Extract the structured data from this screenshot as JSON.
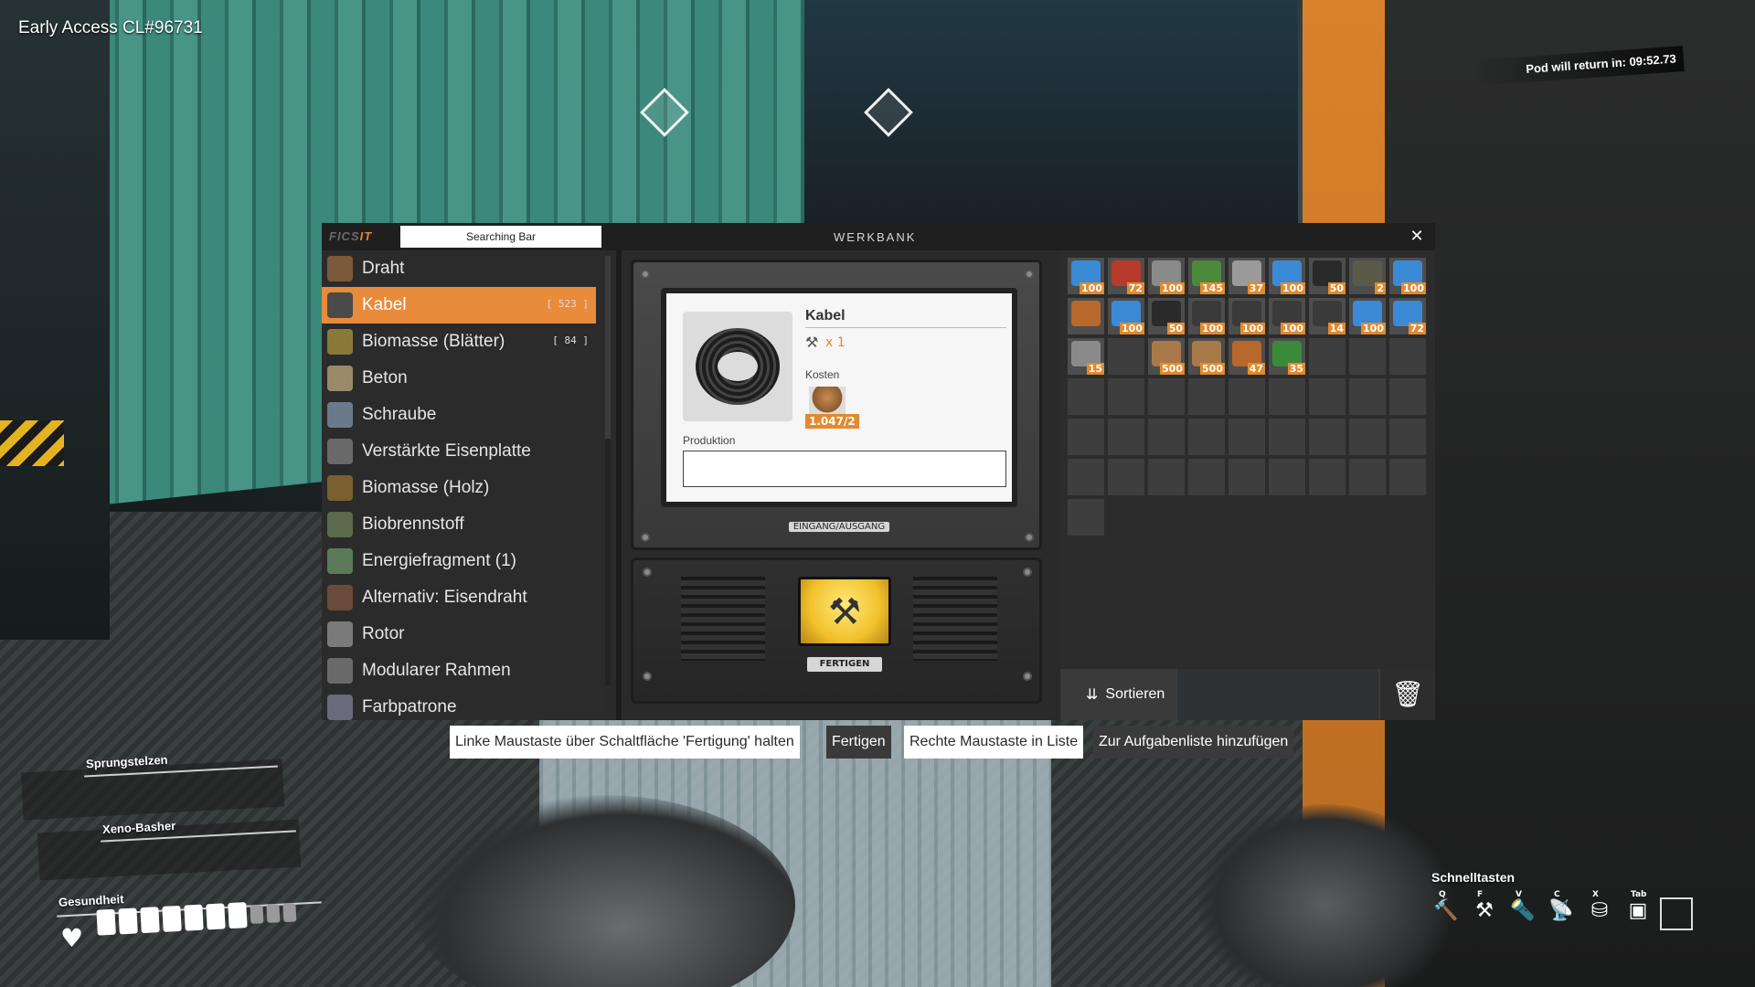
{
  "hud": {
    "version": "Early Access CL#96731",
    "pod_timer": "Pod will return in: 09:52.73"
  },
  "window": {
    "logo_left": "FICS",
    "logo_right": "IT",
    "search_text": "Searching Bar",
    "title": "WERKBANK",
    "close_label": "✕"
  },
  "recipes": [
    {
      "label": "Draht",
      "count": "",
      "color": "#7a5a3a"
    },
    {
      "label": "Kabel",
      "count": "[ 523 ]",
      "color": "#4a4a4a",
      "active": true
    },
    {
      "label": "Biomasse (Blätter)",
      "count": "[ 84 ]",
      "color": "#8a7a3a"
    },
    {
      "label": "Beton",
      "count": "",
      "color": "#9a8a6a"
    },
    {
      "label": "Schraube",
      "count": "",
      "color": "#6a7a8a"
    },
    {
      "label": "Verstärkte Eisenplatte",
      "count": "",
      "color": "#6a6a6a"
    },
    {
      "label": "Biomasse (Holz)",
      "count": "",
      "color": "#7a6030"
    },
    {
      "label": "Biobrennstoff",
      "count": "",
      "color": "#5a6a4a"
    },
    {
      "label": "Energiefragment (1)",
      "count": "",
      "color": "#5a7a5a"
    },
    {
      "label": "Alternativ: Eisendraht",
      "count": "",
      "color": "#6a4a3a"
    },
    {
      "label": "Rotor",
      "count": "",
      "color": "#7a7a7a"
    },
    {
      "label": "Modularer Rahmen",
      "count": "",
      "color": "#6a6a6a"
    },
    {
      "label": "Farbpatrone",
      "count": "",
      "color": "#6a6a7a"
    }
  ],
  "product": {
    "name": "Kabel",
    "quantity": "1",
    "tool_mult": "x 1",
    "cost_label": "Kosten",
    "cost_value": "1.047/2",
    "production_label": "Produktion",
    "io_label": "EINGANG/AUSGANG",
    "craft_label": "FERTIGEN"
  },
  "inventory": {
    "slots": [
      {
        "count": "100",
        "color": "#3a8ad6"
      },
      {
        "count": "72",
        "color": "#b83a2a"
      },
      {
        "count": "100",
        "color": "#8a8a8a"
      },
      {
        "count": "145",
        "color": "#4a8a3a"
      },
      {
        "count": "37",
        "color": "#9a9a9a"
      },
      {
        "count": "100",
        "color": "#3a8ad6"
      },
      {
        "count": "50",
        "color": "#2a2a2a"
      },
      {
        "count": "2",
        "color": "#5a5a4a"
      },
      {
        "count": "100",
        "color": "#3a8ad6"
      },
      {
        "count": "",
        "color": "#b8682a"
      },
      {
        "count": "100",
        "color": "#3a8ad6"
      },
      {
        "count": "50",
        "color": "#2a2a2a"
      },
      {
        "count": "100",
        "color": "#3a3a3a"
      },
      {
        "count": "100",
        "color": "#3a3a3a"
      },
      {
        "count": "100",
        "color": "#3a3a3a"
      },
      {
        "count": "14",
        "color": "#3a3a3a"
      },
      {
        "count": "100",
        "color": "#3a8ad6"
      },
      {
        "count": "72",
        "color": "#3a8ad6"
      },
      {
        "count": "15",
        "color": "#8a8a8a"
      },
      {
        "count": "",
        "color": ""
      },
      {
        "count": "500",
        "color": "#a87a4a"
      },
      {
        "count": "500",
        "color": "#a87a4a"
      },
      {
        "count": "47",
        "color": "#b8682a"
      },
      {
        "count": "35",
        "color": "#3a8a3a"
      },
      {
        "count": "",
        "color": ""
      },
      {
        "count": "",
        "color": ""
      },
      {
        "count": "",
        "color": ""
      }
    ],
    "empty_slot_count": 28,
    "sort_label": "Sortieren",
    "trash_label": "🗑"
  },
  "hints": {
    "hold_text": "Linke Maustaste über Schaltfläche 'Fertigung' halten",
    "hold_action": "Fertigen",
    "right_text": "Rechte Maustaste in Liste",
    "right_action": "Zur Aufgabenliste hinzufügen"
  },
  "equipment": {
    "slot1": "Sprungstelzen",
    "slot2": "Xeno-Basher",
    "health_label": "Gesundheit",
    "health_full_segments": 7,
    "health_total_segments": 10
  },
  "quickbar": {
    "title": "Schnelltasten",
    "slots": [
      {
        "key": "Q",
        "icon": "🔨"
      },
      {
        "key": "F",
        "icon": "⚒"
      },
      {
        "key": "V",
        "icon": "🔦"
      },
      {
        "key": "C",
        "icon": "📡"
      },
      {
        "key": "X",
        "icon": "⛁"
      },
      {
        "key": "Tab",
        "icon": "▣"
      }
    ]
  }
}
